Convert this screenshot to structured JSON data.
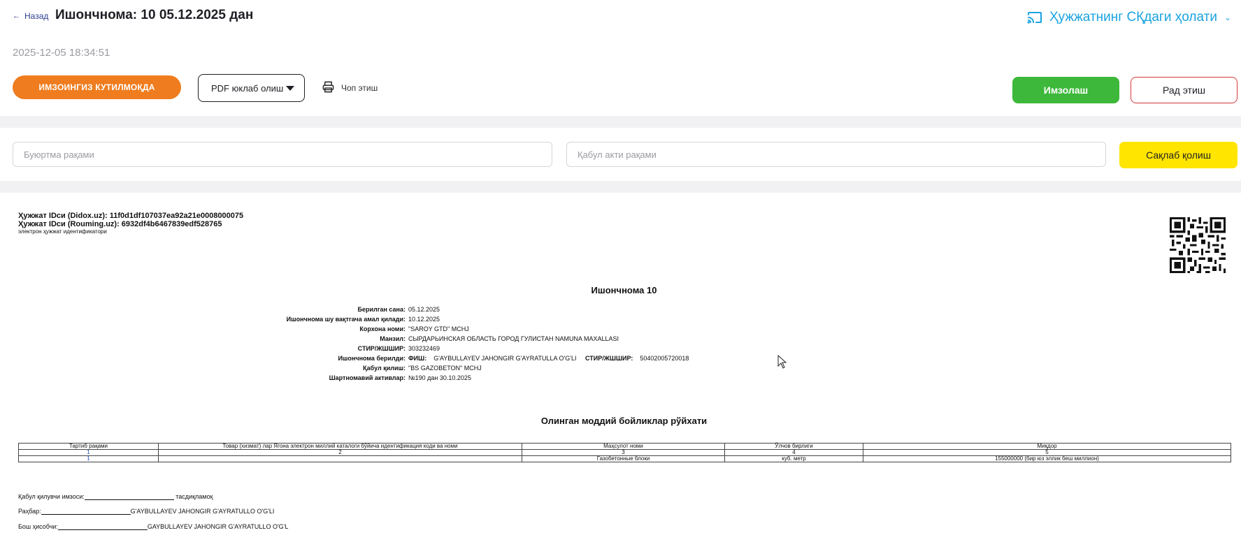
{
  "header": {
    "back_label": "Назад",
    "title": "Ишончнома: 10 05.12.2025 дан",
    "status_link": "Ҳужжатнинг СҚдаги ҳолати",
    "timestamp": "2025-12-05 18:34:51"
  },
  "actions": {
    "awaiting_signature": "ИМЗОИНГИЗ КУТИЛМОҚДА",
    "pdf_download": "PDF юклаб олиш",
    "print": "Чоп этиш",
    "sign": "Имзолаш",
    "reject": "Рад этиш"
  },
  "form": {
    "order_placeholder": "Буюртма рақами",
    "acceptance_placeholder": "Қабул акти рақами",
    "save": "Сақлаб қолиш"
  },
  "document": {
    "id_didox": "Ҳужжат IDси (Didox.uz): 11f0d1df107037ea92a21e0008000075",
    "id_rouming": "Ҳужжат IDси (Rouming.uz): 6932df4b6467839edf528765",
    "id_caption": "электрон ҳужжат идентификатори",
    "title": "Ишончнома 10",
    "fields": [
      {
        "label": "Берилган сана:",
        "value": "05.12.2025"
      },
      {
        "label": "Ишончнома шу вақтгача амал қилади:",
        "value": "10.12.2025"
      },
      {
        "label": "Корхона номи:",
        "value": "\"SAROY GTD\" MCHJ"
      },
      {
        "label": "Манзил:",
        "value": "СЫРДАРЬИНСКАЯ ОБЛАСТЬ ГОРОД ГУЛИСТАН NAMUNA MAXALLASI"
      },
      {
        "label": "СТИР/ЖШШИР:",
        "value": "303232469"
      },
      {
        "label": "Ишончнома берилди:",
        "value": "G'AYBULLAYEV JAHONGIR G'AYRATULLA O'G'LI",
        "fio_label": "ФИШ:",
        "stir_label": "СТИР/ЖШШИР:",
        "stir_value": "50402005720018"
      },
      {
        "label": "Қабул қилиш:",
        "value": "\"BS GAZOBETON\" MCHJ"
      },
      {
        "label": "Шартномавий активлар:",
        "value": "№190 дан 30.10.2025"
      }
    ],
    "list_title": "Олинган моддий бойликлар рўйхати",
    "table": {
      "headers": [
        "Тартиб рақами",
        "Товар (хизмат) лар Ягона электрон миллий каталоги бўйича идентификация коди ва номи",
        "Маҳсулот номи",
        "Ўлчов бирлиги",
        "Миқдор"
      ],
      "numbering": [
        "1",
        "2",
        "3",
        "4",
        "5"
      ],
      "rows": [
        [
          "1",
          "",
          "Газобетонные блоки",
          "куб. метр",
          "155000000 (бир юз эллик беш миллион)"
        ]
      ]
    },
    "signatures": {
      "receiver_label": "Қабул қилувчи имзоси:",
      "receiver_suffix": "тасдиқламоқ",
      "director_label": "Раҳбар:",
      "director_name": "G'AYBULLAYEV JAHONGIR G'AYRATULLO O'G'LI",
      "accountant_label": "Бош ҳисобчи:",
      "accountant_name": "GAYBULLAYEV JAHONGIR G'AYRATULLO O'G'L"
    }
  },
  "colors": {
    "accent_blue": "#1aa3e0",
    "badge_orange": "#ef7c1e",
    "sign_green": "#3db83a",
    "reject_red": "#d63a3a",
    "save_yellow": "#ffe500"
  },
  "icons": [
    "arrow-left-icon",
    "cast-icon",
    "chevron-down-icon",
    "caret-down-icon",
    "printer-icon",
    "qr-code-icon",
    "mouse-pointer-icon"
  ]
}
